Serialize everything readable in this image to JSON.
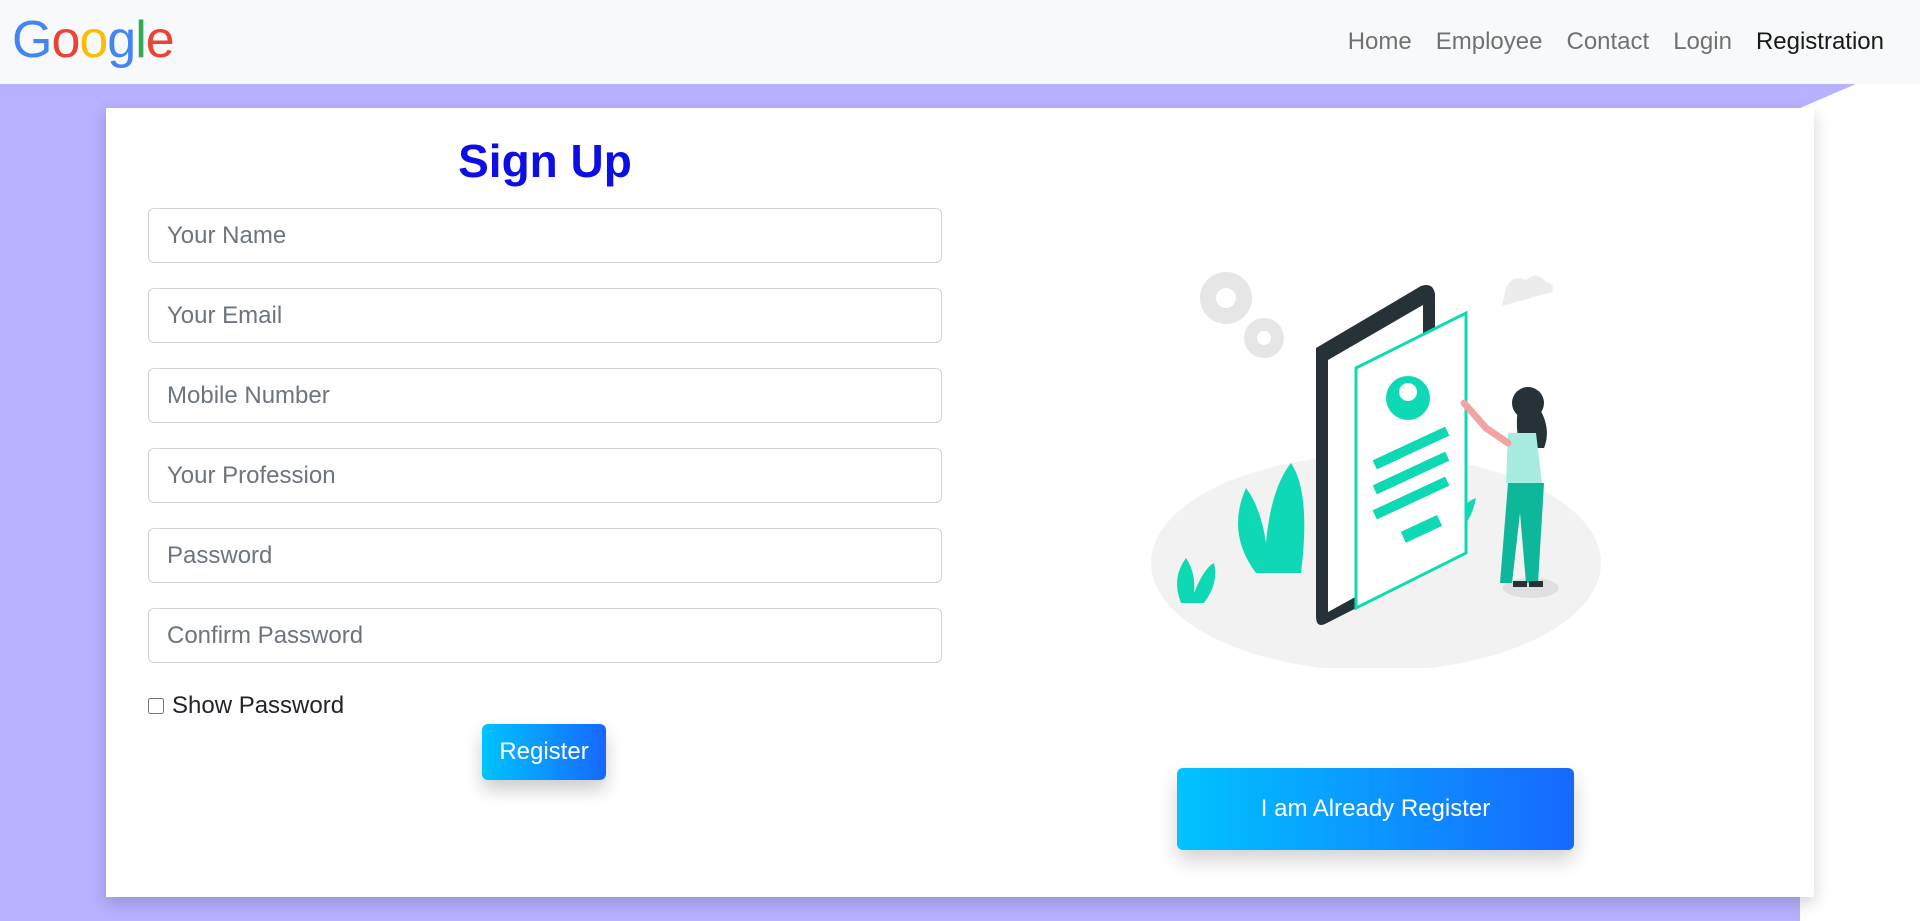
{
  "navbar": {
    "brand": {
      "letters": [
        "G",
        "o",
        "o",
        "g",
        "l",
        "e"
      ],
      "colors": [
        "#4285F4",
        "#EA4335",
        "#FBBC05",
        "#4285F4",
        "#34A853",
        "#EA4335"
      ]
    },
    "links": [
      {
        "label": "Home"
      },
      {
        "label": "Employee"
      },
      {
        "label": "Contact"
      },
      {
        "label": "Login"
      },
      {
        "label": "Registration",
        "active": true
      }
    ]
  },
  "form": {
    "title": "Sign Up",
    "fields": {
      "name": {
        "placeholder": "Your Name",
        "value": ""
      },
      "email": {
        "placeholder": "Your Email",
        "value": ""
      },
      "mobile": {
        "placeholder": "Mobile Number",
        "value": ""
      },
      "profession": {
        "placeholder": "Your Profession",
        "value": ""
      },
      "password": {
        "placeholder": "Password",
        "value": ""
      },
      "confirm": {
        "placeholder": "Confirm Password",
        "value": ""
      }
    },
    "show_password_label": "Show Password",
    "show_password_checked": false,
    "register_label": "Register"
  },
  "side": {
    "illustration_icon": "mobile-signup-illustration",
    "already_label": "I am Already Register"
  },
  "colors": {
    "background_shape": "#b7b1ff",
    "title": "#0d0de6",
    "button_gradient_start": "#00c3ff",
    "button_gradient_end": "#1768ff",
    "illustration_accent": "#0fd8b4"
  }
}
